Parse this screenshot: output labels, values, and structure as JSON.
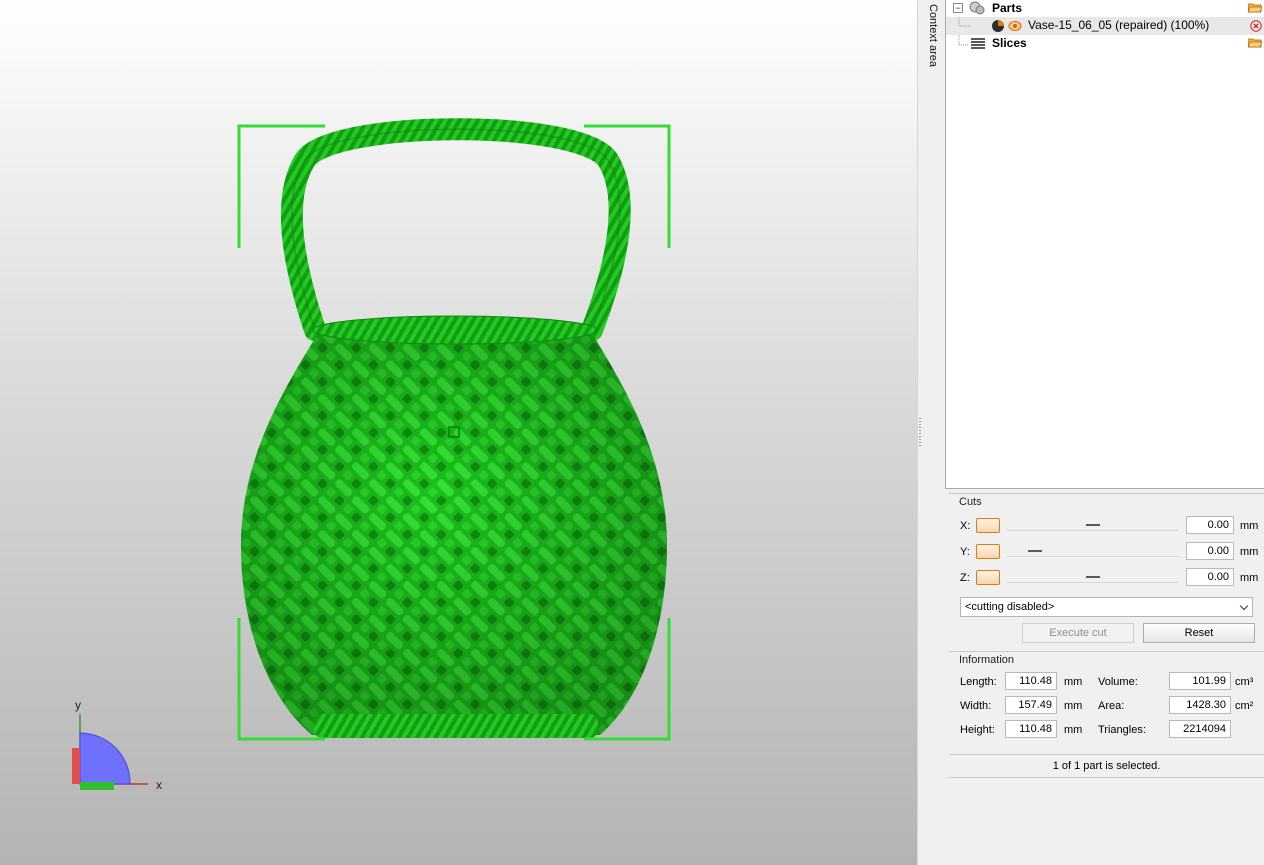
{
  "context_tab": {
    "label": "Context area"
  },
  "tree": {
    "parts": {
      "label": "Parts"
    },
    "part_item": {
      "label": "Vase-15_06_05 (repaired) (100%)"
    },
    "slices": {
      "label": "Slices"
    }
  },
  "axis_indicator": {
    "y": "y",
    "x": "x"
  },
  "cuts": {
    "title": "Cuts",
    "axes": [
      {
        "label": "X:",
        "value": "0.00",
        "unit": "mm"
      },
      {
        "label": "Y:",
        "value": "0.00",
        "unit": "mm"
      },
      {
        "label": "Z:",
        "value": "0.00",
        "unit": "mm"
      }
    ],
    "mode": "<cutting disabled>",
    "execute_label": "Execute cut",
    "reset_label": "Reset"
  },
  "information": {
    "title": "Information",
    "length": {
      "label": "Length:",
      "value": "110.48",
      "unit": "mm"
    },
    "width": {
      "label": "Width:",
      "value": "157.49",
      "unit": "mm"
    },
    "height": {
      "label": "Height:",
      "value": "110.48",
      "unit": "mm"
    },
    "volume": {
      "label": "Volume:",
      "value": "101.99",
      "unit": "cm³"
    },
    "area": {
      "label": "Area:",
      "value": "1428.30",
      "unit": "cm²"
    },
    "triangles": {
      "label": "Triangles:",
      "value": "2214094"
    }
  },
  "status": {
    "text": "1 of 1 part is selected."
  },
  "colors": {
    "model": "#22cc22",
    "selection_bracket": "#33dd33",
    "accent": "#e07a16"
  }
}
